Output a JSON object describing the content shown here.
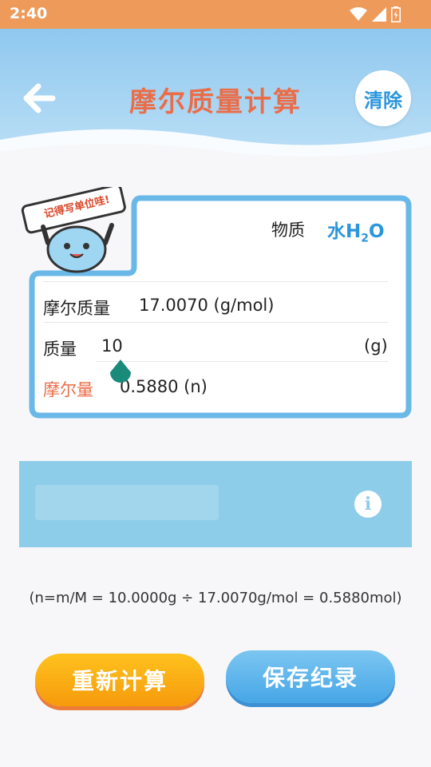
{
  "status_bar": {
    "time": "2:40"
  },
  "header": {
    "title": "摩尔质量计算",
    "clear_label": "清除"
  },
  "card": {
    "sign_text": "记得写单位哇!",
    "substance": {
      "label": "物质",
      "value_prefix": "水H",
      "value_sub": "2",
      "value_suffix": "O"
    },
    "molar_mass": {
      "label": "摩尔质量",
      "value": "17.0070 (g/mol)"
    },
    "mass": {
      "label": "质量",
      "value": "10",
      "unit": "(g)"
    },
    "moles": {
      "label": "摩尔量",
      "value": "0.5880 (n)"
    }
  },
  "formula": "(n=m/M = 10.0000g ÷ 17.0070g/mol = 0.5880mol)",
  "buttons": {
    "recalculate": "重新计算",
    "save": "保存纪录"
  },
  "colors": {
    "accent_orange": "#ea6d48",
    "accent_blue": "#2a96dc",
    "status_bar": "#ee9a5a"
  },
  "icons": [
    "wifi-icon",
    "signal-icon",
    "battery-icon",
    "back-arrow-icon",
    "info-icon"
  ]
}
